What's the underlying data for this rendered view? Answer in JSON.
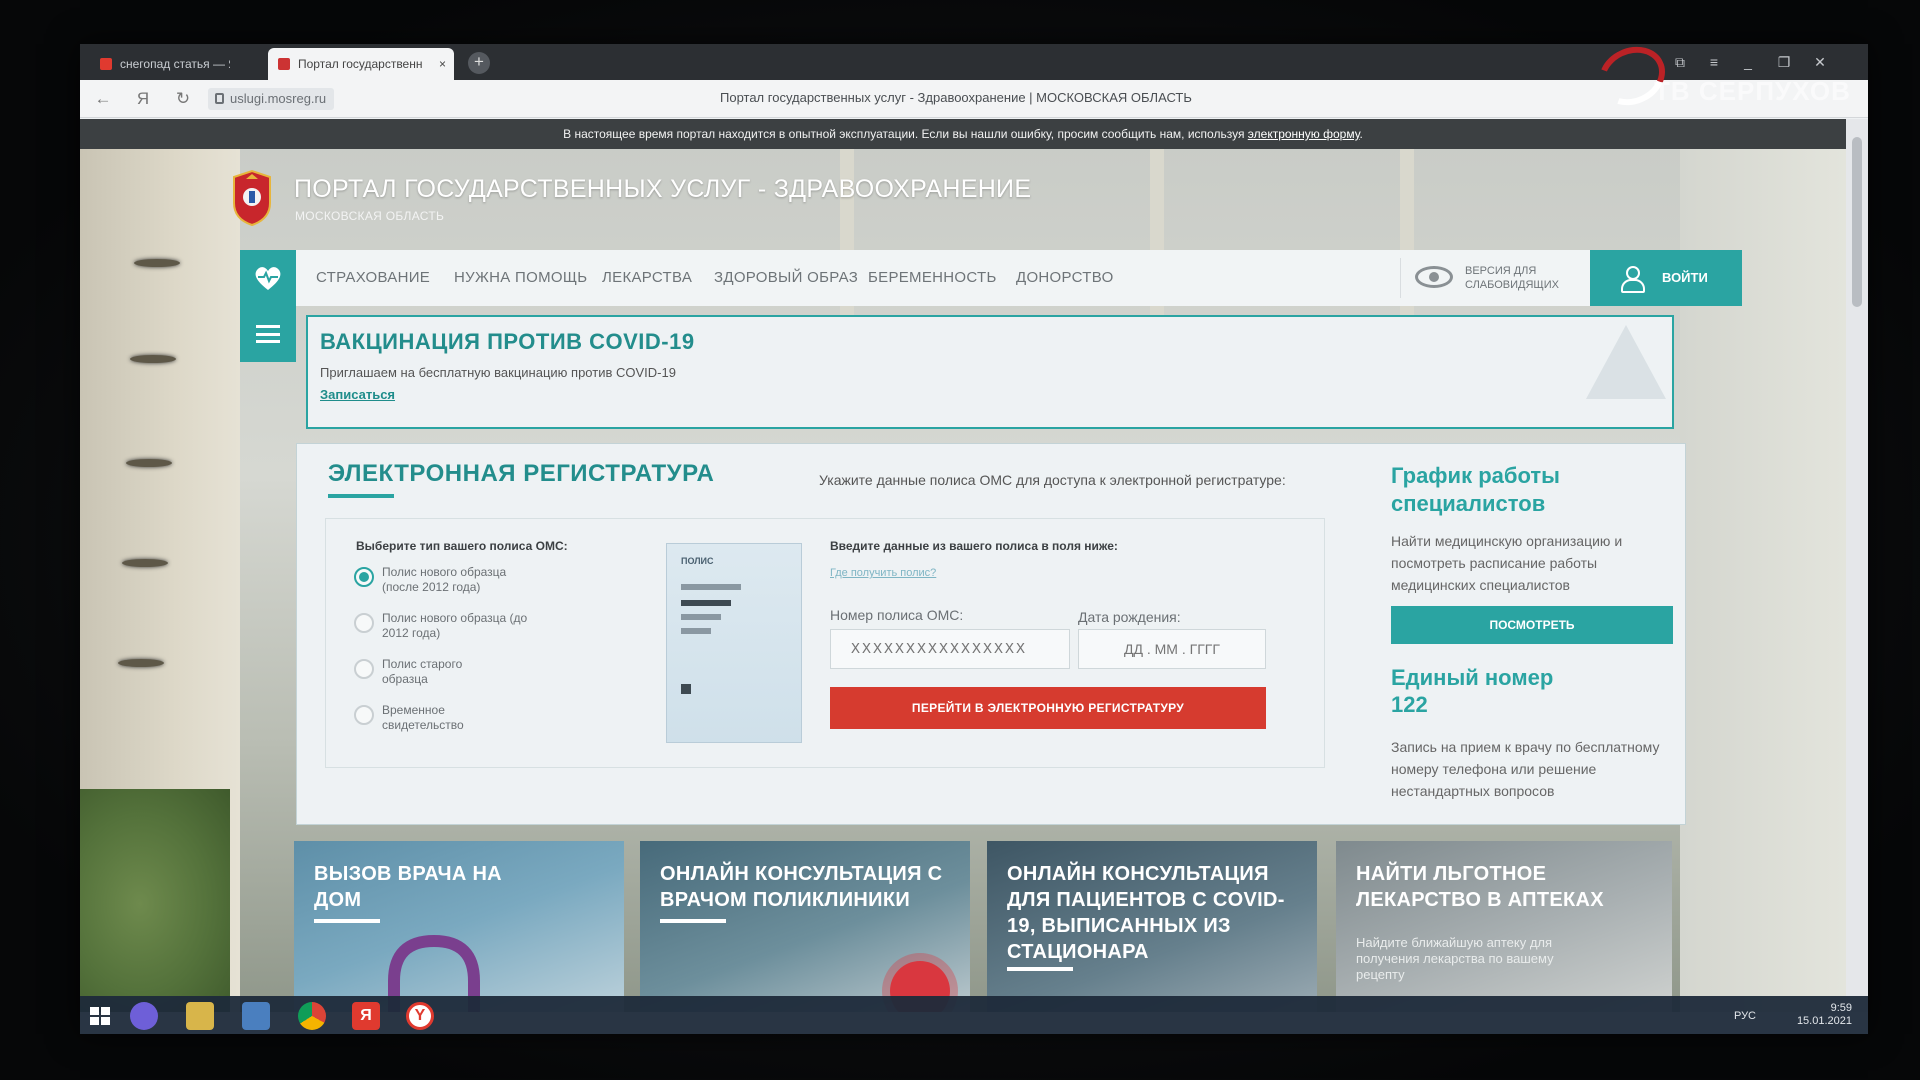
{
  "browser": {
    "tabs": [
      {
        "label": "снегопад статья — Янде",
        "active": false
      },
      {
        "label": "Портал государственн",
        "active": true
      }
    ],
    "new_tab_symbol": "+",
    "url": "uslugi.mosreg.ru",
    "page_title": "Портал государственных услуг - Здравоохранение | МОСКОВСКАЯ ОБЛАСТЬ",
    "back_symbol": "←",
    "yandex_symbol": "Я",
    "reload_symbol": "↻",
    "window_buttons": [
      "⧉",
      "≡",
      "_",
      "❐",
      "✕"
    ]
  },
  "watermark": {
    "channel": "ТВ СЕРПУХОВ"
  },
  "notice": {
    "text": "В настоящее время портал находится в опытной эксплуатации. Если вы нашли ошибку, просим сообщить нам, используя ",
    "link": "электронную форму",
    "end": "."
  },
  "header": {
    "title": "ПОРТАЛ ГОСУДАРСТВЕННЫХ УСЛУГ - ЗДРАВООХРАНЕНИЕ",
    "subtitle": "МОСКОВСКАЯ ОБЛАСТЬ"
  },
  "nav": {
    "items": [
      "СТРАХОВАНИЕ",
      "НУЖНА ПОМОЩЬ",
      "ЛЕКАРСТВА",
      "ЗДОРОВЫЙ ОБРАЗ",
      "БЕРЕМЕННОСТЬ",
      "ДОНОРСТВО"
    ],
    "low_vision": "ВЕРСИЯ ДЛЯ СЛАБОВИДЯЩИХ",
    "login": "ВОЙТИ"
  },
  "covid": {
    "title": "ВАКЦИНАЦИЯ ПРОТИВ COVID-19",
    "text": "Приглашаем на бесплатную вакцинацию против COVID-19",
    "link": "Записаться"
  },
  "registration": {
    "title": "ЭЛЕКТРОННАЯ РЕГИСТРАТУРА",
    "hint": "Укажите данные полиса ОМС для доступа к электронной регистратуре:",
    "type_label": "Выберите тип вашего полиса ОМС:",
    "types": [
      {
        "label": "Полис нового образца (после 2012 года)",
        "selected": true
      },
      {
        "label": "Полис нового образца (до 2012 года)",
        "selected": false
      },
      {
        "label": "Полис старого образца",
        "selected": false
      },
      {
        "label": "Временное свидетельство",
        "selected": false
      }
    ],
    "policy_image_caption": "ПОЛИС",
    "data_label": "Введите данные из вашего полиса в поля ниже:",
    "get_policy_link": "Где получить полис?",
    "oms_label": "Номер полиса ОМС:",
    "oms_placeholder": "XXXXXXXXXXXXXXXX",
    "dob_label": "Дата рождения:",
    "dob_placeholder": "ДД . ММ . ГГГГ",
    "submit": "ПЕРЕЙТИ В ЭЛЕКТРОННУЮ РЕГИСТРАТУРУ"
  },
  "schedule": {
    "title": "График работы специалистов",
    "text": "Найти медицинскую организацию и посмотреть расписание работы медицинских специалистов",
    "button": "ПОСМОТРЕТЬ"
  },
  "hotline": {
    "title": "Единый номер",
    "number": "122",
    "text": "Запись на прием к врачу по бесплатному номеру телефона или решение нестандартных вопросов"
  },
  "tiles": [
    {
      "title": "ВЫЗОВ ВРАЧА НА ДОМ",
      "subtitle": ""
    },
    {
      "title": "ОНЛАЙН КОНСУЛЬТАЦИЯ С ВРАЧОМ ПОЛИКЛИНИКИ",
      "subtitle": ""
    },
    {
      "title": "ОНЛАЙН КОНСУЛЬТАЦИЯ ДЛЯ ПАЦИЕНТОВ С COVID-19, ВЫПИСАННЫХ ИЗ СТАЦИОНАРА",
      "subtitle": ""
    },
    {
      "title": "НАЙТИ ЛЬГОТНОЕ ЛЕКАРСТВО В АПТЕКАХ",
      "subtitle": "Найдите ближайшую аптеку для получения лекарства по вашему рецепту"
    }
  ],
  "taskbar": {
    "icons": [
      "windows-start-icon",
      "cortana-icon",
      "file-explorer-icon",
      "control-panel-icon",
      "chrome-icon",
      "yandex-icon",
      "yandex-browser-icon"
    ],
    "language": "РУС",
    "time": "9:59",
    "date": "15.01.2021"
  },
  "colors": {
    "accent": "#2aa4a2",
    "danger": "#d63b2f",
    "heading": "#238d8c"
  }
}
